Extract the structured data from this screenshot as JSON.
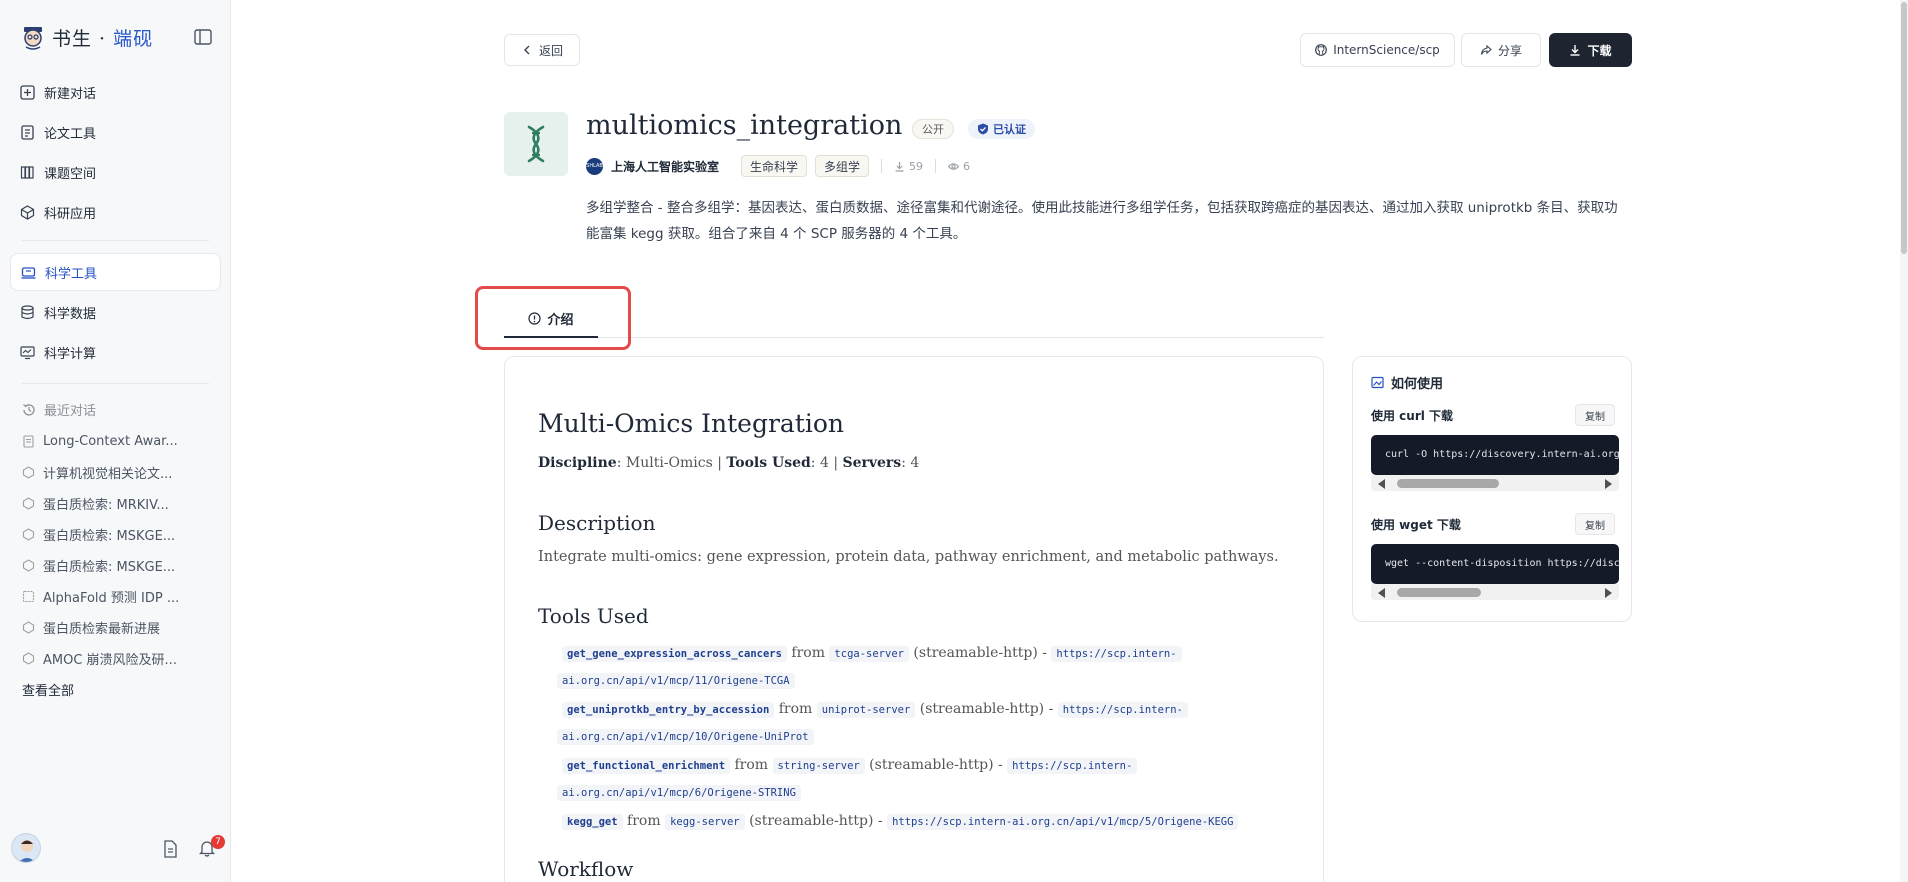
{
  "brand": {
    "name_main": "书生",
    "name_sep": " · ",
    "name_accent": "端砚"
  },
  "nav": [
    {
      "id": "new-chat",
      "label": "新建对话",
      "icon": "plus-square-icon"
    },
    {
      "id": "paper-tools",
      "label": "论文工具",
      "icon": "document-icon"
    },
    {
      "id": "project-space",
      "label": "课题空间",
      "icon": "books-icon"
    },
    {
      "id": "research-apps",
      "label": "科研应用",
      "icon": "cube-icon"
    }
  ],
  "nav2": [
    {
      "id": "science-tools",
      "label": "科学工具",
      "icon": "toolbox-icon",
      "active": true
    },
    {
      "id": "science-data",
      "label": "科学数据",
      "icon": "database-icon"
    },
    {
      "id": "science-compute",
      "label": "科学计算",
      "icon": "monitor-icon"
    }
  ],
  "recent": {
    "heading": "最近对话",
    "items": [
      "Long-Context Awar...",
      "计算机视觉相关论文...",
      "蛋白质检索: MRKIV...",
      "蛋白质检索: MSKGE...",
      "蛋白质检索: MSKGE...",
      "AlphaFold 预测 IDP ...",
      "蛋白质检索最新进展",
      "AMOC 崩溃风险及研..."
    ],
    "view_all": "查看全部"
  },
  "notifications": {
    "count": "7"
  },
  "toolbar": {
    "back": "返回",
    "github": "InternScience/scp",
    "share": "分享",
    "download": "下载"
  },
  "tool": {
    "title": "multiomics_integration",
    "visibility": "公开",
    "verified": "已认证",
    "org_logo_text": "SHLAB",
    "org": "上海人工智能实验室",
    "tags": [
      "生命科学",
      "多组学"
    ],
    "downloads": "59",
    "views": "6",
    "description": "多组学整合 - 整合多组学：基因表达、蛋白质数据、途径富集和代谢途径。使用此技能进行多组学任务，包括获取跨癌症的基因表达、通过加入获取 uniprotkb 条目、获取功能富集 kegg 获取。组合了来自 4 个 SCP 服务器的 4 个工具。"
  },
  "tabs": {
    "intro": "介绍"
  },
  "content": {
    "h1": "Multi-Omics Integration",
    "meta": {
      "discipline_label": "Discipline",
      "discipline": "Multi-Omics",
      "tools_label": "Tools Used",
      "tools": "4",
      "servers_label": "Servers",
      "servers": "4"
    },
    "desc_heading": "Description",
    "desc_text": "Integrate multi-omics: gene expression, protein data, pathway enrichment, and metabolic pathways.",
    "tools_heading": "Tools Used",
    "tools_list": [
      {
        "fn": "get_gene_expression_across_cancers",
        "from": "from",
        "server": "tcga-server",
        "proto": "(streamable-http) -",
        "url": "https://scp.intern-",
        "url2": "ai.org.cn/api/v1/mcp/11/Origene-TCGA"
      },
      {
        "fn": "get_uniprotkb_entry_by_accession",
        "from": "from",
        "server": "uniprot-server",
        "proto": "(streamable-http) -",
        "url": "https://scp.intern-",
        "url2": "ai.org.cn/api/v1/mcp/10/Origene-UniProt"
      },
      {
        "fn": "get_functional_enrichment",
        "from": "from",
        "server": "string-server",
        "proto": "(streamable-http) -",
        "url": "https://scp.intern-",
        "url2": "ai.org.cn/api/v1/mcp/6/Origene-STRING"
      },
      {
        "fn": "kegg_get",
        "from": "from",
        "server": "kegg-server",
        "proto": "(streamable-http) -",
        "url": "https://scp.intern-ai.org.cn/api/v1/mcp/5/Origene-KEGG",
        "url2": ""
      }
    ],
    "workflow_heading": "Workflow"
  },
  "usage": {
    "title": "如何使用",
    "curl_label": "使用 curl 下载",
    "curl_cmd": "curl -O https://discovery.intern-ai.org.cn/d",
    "wget_label": "使用 wget 下载",
    "wget_cmd": "wget --content-disposition https://discovery",
    "copy": "复制"
  },
  "colors": {
    "accent": "#2350c4",
    "dark_button": "#1e2531",
    "highlight": "#e34b4b",
    "code_bg": "#141a27"
  }
}
